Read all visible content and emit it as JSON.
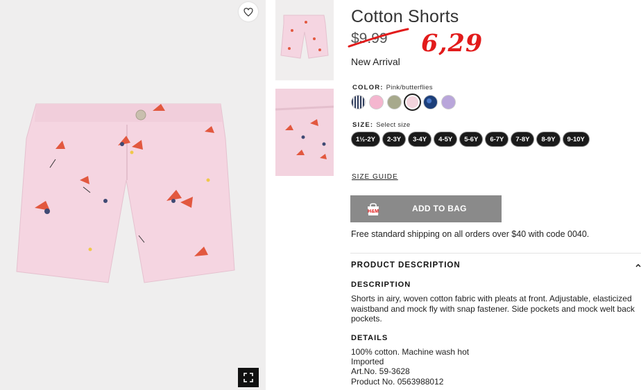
{
  "product": {
    "title": "Cotton Shorts",
    "old_price": "$9.99",
    "sale_price": "6,29",
    "badge": "New Arrival"
  },
  "color": {
    "label": "COLOR:",
    "value": "Pink/butterflies",
    "swatches": [
      {
        "name": "navy-stripe",
        "color": "#3a4a6b"
      },
      {
        "name": "light-pink",
        "color": "#f4b6cf"
      },
      {
        "name": "sage",
        "color": "#a7a98c"
      },
      {
        "name": "pink-butterflies",
        "color": "#f2d4dd",
        "selected": true
      },
      {
        "name": "blue-print",
        "color": "#1d3f7a"
      },
      {
        "name": "lavender",
        "color": "#b9a6da"
      }
    ]
  },
  "size": {
    "label": "SIZE:",
    "placeholder": "Select size",
    "options": [
      "1½-2Y",
      "2-3Y",
      "3-4Y",
      "4-5Y",
      "5-6Y",
      "6-7Y",
      "7-8Y",
      "8-9Y",
      "9-10Y"
    ]
  },
  "size_guide": "SIZE GUIDE",
  "add_to_bag": "ADD TO BAG",
  "shipping_note": "Free standard shipping on all orders over $40 with code 0040.",
  "product_description": {
    "header": "PRODUCT DESCRIPTION",
    "description_label": "DESCRIPTION",
    "description_text": "Shorts in airy, woven cotton fabric with pleats at front. Adjustable, elasticized waistband and mock fly with snap fastener. Side pockets and mock welt back pockets.",
    "details_label": "DETAILS",
    "details": [
      "100% cotton. Machine wash hot",
      "Imported",
      "Art.No. 59-3628",
      "Product No. 0563988012"
    ]
  },
  "icons": {
    "favorite": "heart-icon",
    "fullscreen": "fullscreen-icon",
    "bag": "shopping-bag-icon",
    "collapse": "chevron-up-icon"
  },
  "colors": {
    "sale_red": "#e21b1b",
    "button_gray": "#8a8a8a",
    "chip_black": "#1a1a1a"
  }
}
